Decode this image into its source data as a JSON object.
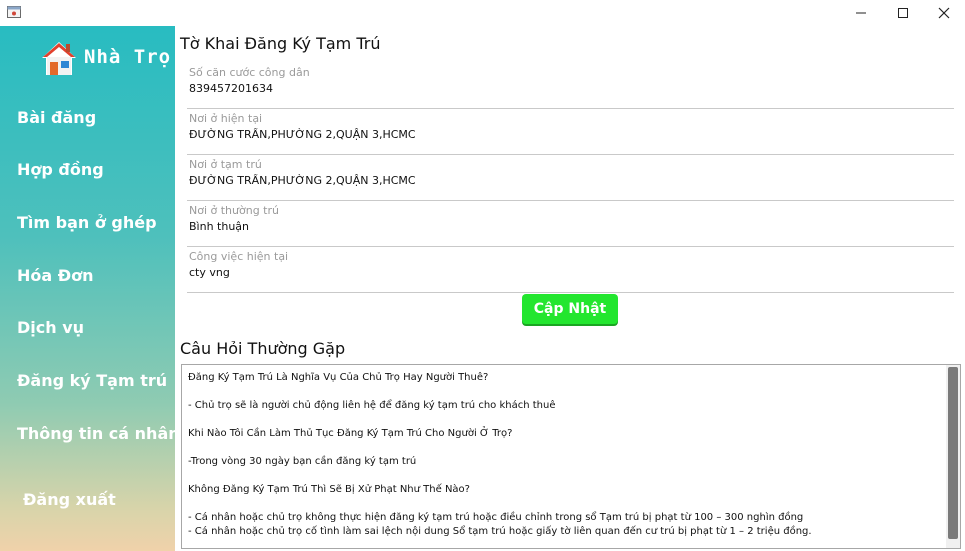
{
  "window": {
    "controls": {
      "minimize": "─",
      "maximize": "☐",
      "close": "✕"
    }
  },
  "sidebar": {
    "brand": "Nhà Trọ",
    "items": [
      {
        "label": "Bài đăng"
      },
      {
        "label": "Hợp đồng"
      },
      {
        "label": "Tìm bạn ở ghép"
      },
      {
        "label": "Hóa Đơn"
      },
      {
        "label": "Dịch vụ"
      },
      {
        "label": "Đăng ký Tạm trú"
      },
      {
        "label": "Thông tin cá nhân"
      },
      {
        "label": "Đăng xuất"
      }
    ]
  },
  "form": {
    "title": "Tờ Khai Đăng Ký Tạm Trú",
    "fields": [
      {
        "label": "Số căn cước công dân",
        "value": "839457201634"
      },
      {
        "label": "Nơi ở hiện tại",
        "value": "ĐƯỜNG TRẦN,PHƯỜNG 2,QUẬN 3,HCMC"
      },
      {
        "label": "Nơi ở tạm trú",
        "value": "ĐƯỜNG TRẦN,PHƯỜNG 2,QUẬN 3,HCMC"
      },
      {
        "label": "Nơi ở thường trú",
        "value": "Bình thuận"
      },
      {
        "label": "Công việc hiện tại",
        "value": "cty vng"
      }
    ],
    "update_button": "Cập Nhật"
  },
  "faq": {
    "title": "Câu Hỏi Thường Gặp",
    "lines": [
      "Đăng Ký Tạm Trú Là Nghĩa Vụ Của Chủ Trọ Hay Người Thuê?",
      "",
      "- Chủ trọ sẽ là người chủ động liên hệ để đăng ký tạm trú cho khách thuê",
      "",
      "Khi Nào Tôi Cần Làm Thủ Tục Đăng Ký Tạm Trú Cho Người Ở Trọ?",
      "",
      "-Trong vòng 30 ngày bạn cần đăng ký tạm trú",
      "",
      "Không Đăng Ký Tạm Trú Thì Sẽ Bị Xử Phạt Như Thế Nào?",
      "",
      "- Cá nhân hoặc chủ trọ không thực hiện đăng ký tạm trú hoặc điều chỉnh trong sổ Tạm trú bị phạt từ 100 – 300 nghìn đồng",
      "- Cá nhân hoặc chủ trọ cố tình làm sai lệch nội dung Sổ tạm trú hoặc giấy tờ liên quan đến cư trú bị phạt từ 1 – 2 triệu đồng."
    ]
  }
}
